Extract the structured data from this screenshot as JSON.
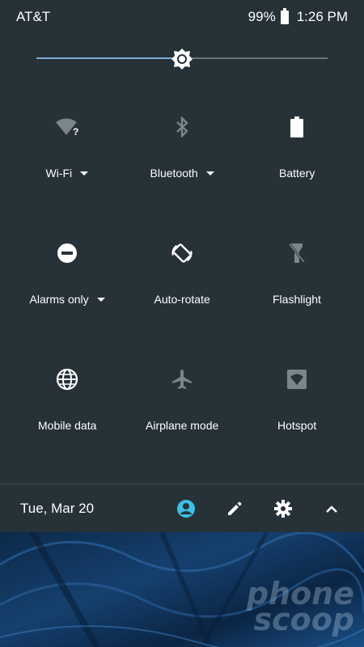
{
  "status_bar": {
    "carrier": "AT&T",
    "battery_level": "99%",
    "time": "1:26 PM"
  },
  "brightness": {
    "level": 0.5
  },
  "tiles": [
    {
      "label": "Wi-Fi",
      "icon": "wifi-unknown-icon",
      "has_dropdown": true
    },
    {
      "label": "Bluetooth",
      "icon": "bluetooth-off-icon",
      "has_dropdown": true
    },
    {
      "label": "Battery",
      "icon": "battery-full-icon",
      "has_dropdown": false
    },
    {
      "label": "Alarms only",
      "icon": "do-not-disturb-icon",
      "has_dropdown": true
    },
    {
      "label": "Auto-rotate",
      "icon": "auto-rotate-icon",
      "has_dropdown": false
    },
    {
      "label": "Flashlight",
      "icon": "flashlight-off-icon",
      "has_dropdown": false
    },
    {
      "label": "Mobile data",
      "icon": "globe-icon",
      "has_dropdown": false
    },
    {
      "label": "Airplane mode",
      "icon": "airplane-icon",
      "has_dropdown": false
    },
    {
      "label": "Hotspot",
      "icon": "hotspot-icon",
      "has_dropdown": false
    }
  ],
  "footer": {
    "date": "Tue, Mar 20",
    "icons": [
      "user-account-icon",
      "edit-pencil-icon",
      "settings-gear-icon",
      "collapse-chevron-up-icon"
    ]
  },
  "wallpaper": {
    "watermark_line1": "phone",
    "watermark_line2": "scoop"
  },
  "colors": {
    "shade_bg": "#263238",
    "accent": "#7fa9d9",
    "user_icon": "#3cc0e6",
    "dim_icon": "#7c858a"
  }
}
